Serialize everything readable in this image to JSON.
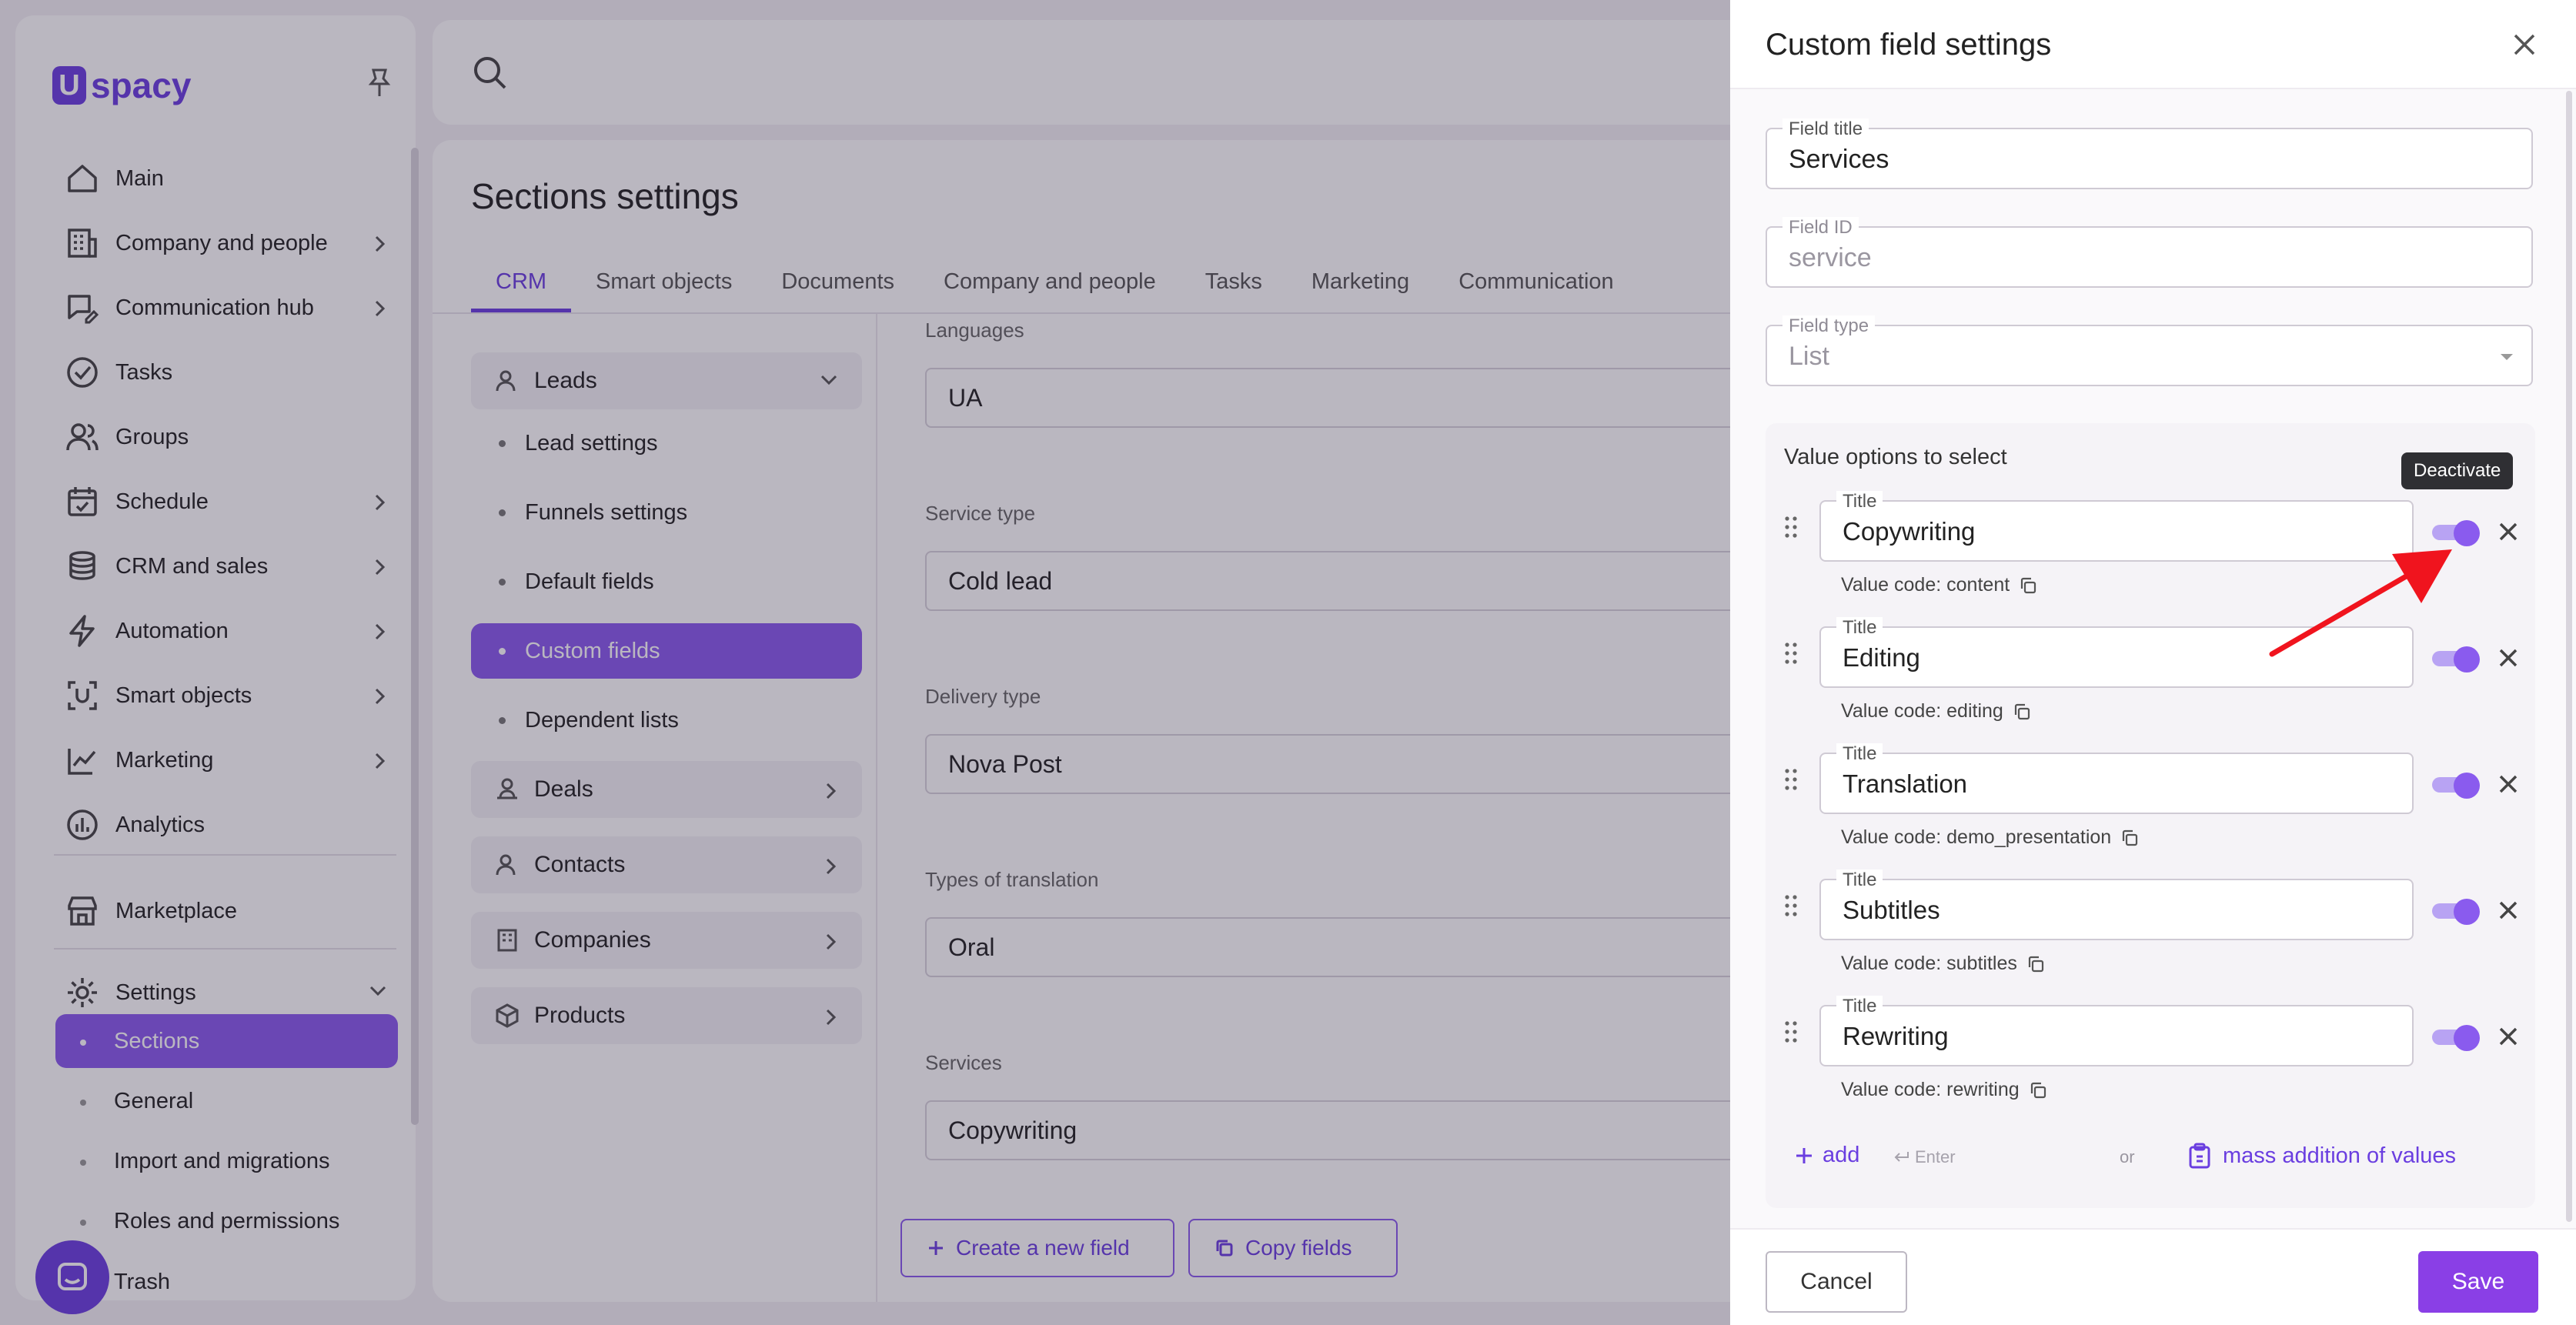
{
  "app": {
    "logo": "spacy",
    "logo_mark": "U"
  },
  "sidebar": {
    "items": [
      {
        "label": "Main",
        "icon": "home-icon"
      },
      {
        "label": "Company and people",
        "icon": "building-icon"
      },
      {
        "label": "Communication hub",
        "icon": "chat-edit-icon"
      },
      {
        "label": "Tasks",
        "icon": "check-circle-icon"
      },
      {
        "label": "Groups",
        "icon": "users-icon"
      },
      {
        "label": "Schedule",
        "icon": "calendar-icon"
      },
      {
        "label": "CRM and sales",
        "icon": "coins-icon"
      },
      {
        "label": "Automation",
        "icon": "bolt-icon"
      },
      {
        "label": "Smart objects",
        "icon": "scan-icon"
      },
      {
        "label": "Marketing",
        "icon": "megaphone-icon"
      },
      {
        "label": "Analytics",
        "icon": "chart-icon"
      },
      {
        "label": "Marketplace",
        "icon": "store-icon"
      },
      {
        "label": "Settings",
        "icon": "gear-icon"
      }
    ],
    "settings_sub": [
      "Sections",
      "General",
      "Import and migrations",
      "Roles and permissions",
      "Trash"
    ]
  },
  "main": {
    "title": "Sections settings",
    "tabs": [
      "CRM",
      "Smart objects",
      "Documents",
      "Company and people",
      "Tasks",
      "Marketing",
      "Communication"
    ],
    "left_menu": {
      "leads": "Leads",
      "leads_items": [
        "Lead settings",
        "Funnels settings",
        "Default fields",
        "Custom fields",
        "Dependent lists"
      ],
      "groups": [
        "Deals",
        "Contacts",
        "Companies",
        "Products"
      ]
    },
    "fields": [
      {
        "label": "Languages",
        "value": "UA"
      },
      {
        "label": "Service type",
        "value": "Cold lead"
      },
      {
        "label": "Delivery type",
        "value": "Nova Post"
      },
      {
        "label": "Types of translation",
        "value": "Oral"
      },
      {
        "label": "Services",
        "value": "Copywriting"
      }
    ],
    "create_field": "Create a new field",
    "copy_fields": "Copy fields"
  },
  "drawer": {
    "title": "Custom field settings",
    "field_title_label": "Field title",
    "field_title_value": "Services",
    "field_id_label": "Field ID",
    "field_id_value": "service",
    "field_type_label": "Field type",
    "field_type_value": "List",
    "options_title": "Value options to select",
    "row_label": "Title",
    "value_code_prefix": "Value code:",
    "options": [
      {
        "title": "Copywriting",
        "code": "content",
        "active": true
      },
      {
        "title": "Editing",
        "code": "editing",
        "active": true
      },
      {
        "title": "Translation",
        "code": "demo_presentation",
        "active": true
      },
      {
        "title": "Subtitles",
        "code": "subtitles",
        "active": true
      },
      {
        "title": "Rewriting",
        "code": "rewriting",
        "active": true
      }
    ],
    "add": "add",
    "enter_hint": "Enter",
    "or": "or",
    "mass_add": "mass addition of values",
    "tooltip": "Deactivate",
    "cancel": "Cancel",
    "save": "Save"
  },
  "colors": {
    "accent": "#8a5bee",
    "brand": "#6a3ee0",
    "annotation_arrow": "#f0141e"
  }
}
